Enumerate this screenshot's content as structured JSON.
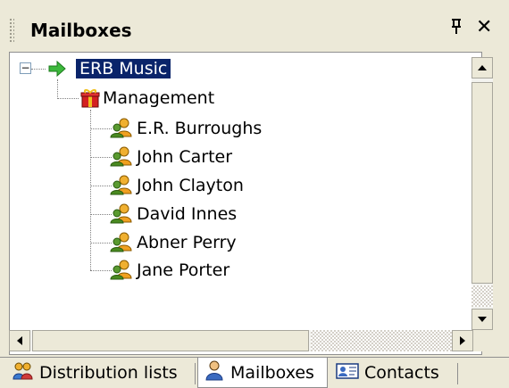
{
  "panel": {
    "title": "Mailboxes",
    "pin_glyph": "Ɣ",
    "close_glyph": "✕"
  },
  "tree": {
    "root": {
      "label": "ERB Music",
      "icon": "green-arrow-icon",
      "expander": "−"
    },
    "group": {
      "label": "Management",
      "icon": "gift-box-icon"
    },
    "users": [
      {
        "label": "E.R. Burroughs",
        "icon": "user-group-icon"
      },
      {
        "label": "John Carter",
        "icon": "user-group-icon"
      },
      {
        "label": "John Clayton",
        "icon": "user-group-icon"
      },
      {
        "label": "David Innes",
        "icon": "user-group-icon"
      },
      {
        "label": "Abner Perry",
        "icon": "user-group-icon"
      },
      {
        "label": "Jane Porter",
        "icon": "user-group-icon"
      }
    ]
  },
  "tabs": [
    {
      "label": "Distribution lists",
      "icon": "distribution-list-icon",
      "active": false
    },
    {
      "label": "Mailboxes",
      "icon": "mailbox-user-icon",
      "active": true
    },
    {
      "label": "Contacts",
      "icon": "contact-card-icon",
      "active": false
    }
  ],
  "colors": {
    "selection": "#0a246a",
    "chrome": "#ece9d8"
  }
}
